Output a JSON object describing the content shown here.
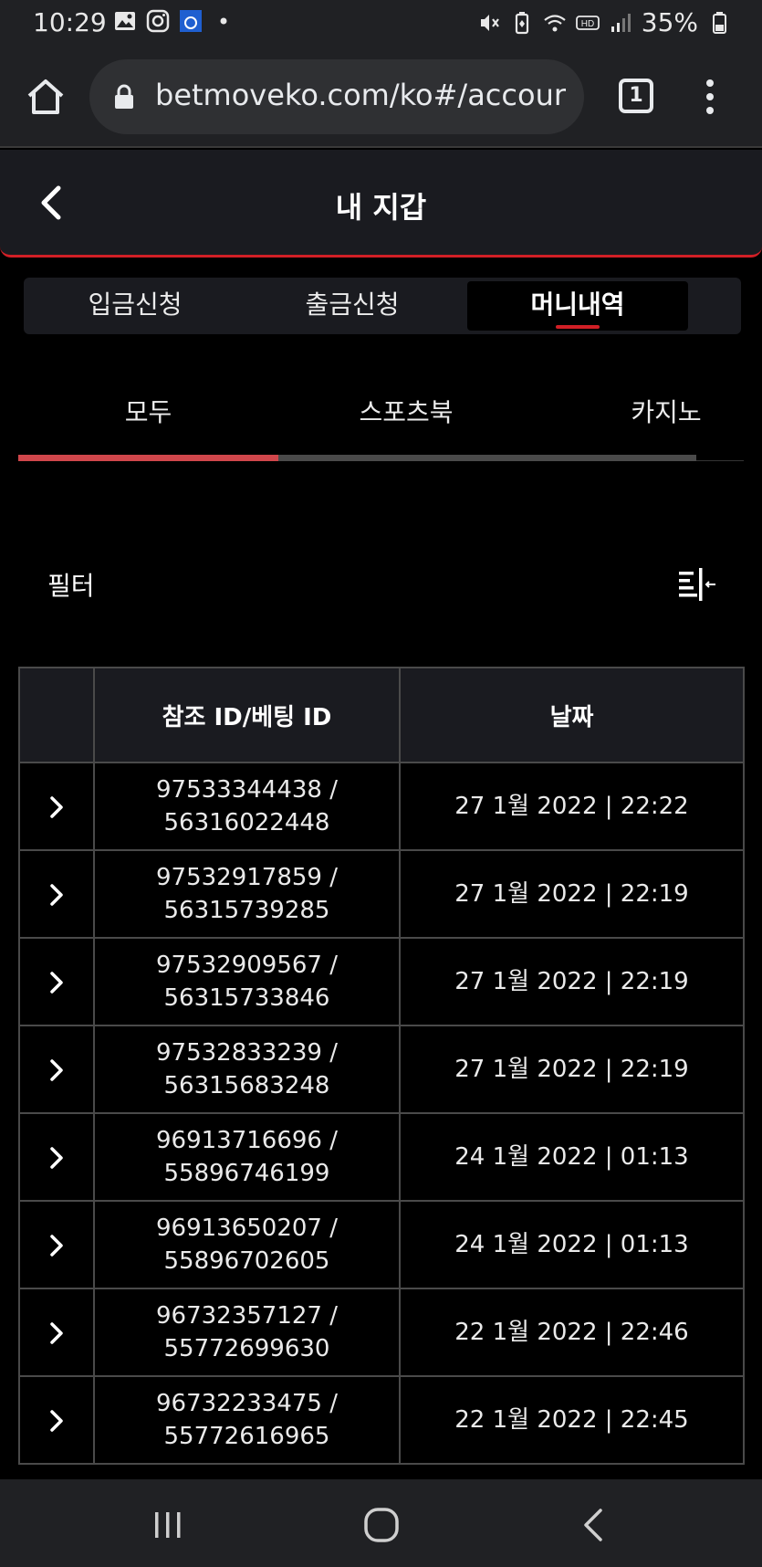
{
  "status_bar": {
    "time": "10:29",
    "battery": "35%",
    "icons": [
      "gallery-icon",
      "instagram-icon",
      "app-icon",
      "dot-icon",
      "mute-icon",
      "battery-saver-icon",
      "wifi-icon",
      "hd-icon",
      "signal-icon",
      "battery-icon"
    ]
  },
  "browser": {
    "url": "betmoveko.com/ko#/accour",
    "tab_count": "1"
  },
  "header": {
    "title": "내 지갑"
  },
  "main_tabs": [
    {
      "label": "입금신청",
      "active": false
    },
    {
      "label": "출금신청",
      "active": false
    },
    {
      "label": "머니내역",
      "active": true
    }
  ],
  "sub_tabs": [
    {
      "label": "모두",
      "active": true
    },
    {
      "label": "스포츠북",
      "active": false
    },
    {
      "label": "카지노",
      "active": false
    }
  ],
  "filter": {
    "label": "필터"
  },
  "table": {
    "headers": [
      "",
      "참조 ID/베팅 ID",
      "날짜"
    ],
    "rows": [
      {
        "ref_id": "97533344438 /",
        "bet_id": "56316022448",
        "date": "27 1월 2022 | 22:22"
      },
      {
        "ref_id": "97532917859 /",
        "bet_id": "56315739285",
        "date": "27 1월 2022 | 22:19"
      },
      {
        "ref_id": "97532909567 /",
        "bet_id": "56315733846",
        "date": "27 1월 2022 | 22:19"
      },
      {
        "ref_id": "97532833239 /",
        "bet_id": "56315683248",
        "date": "27 1월 2022 | 22:19"
      },
      {
        "ref_id": "96913716696 /",
        "bet_id": "55896746199",
        "date": "24 1월 2022 | 01:13"
      },
      {
        "ref_id": "96913650207 /",
        "bet_id": "55896702605",
        "date": "24 1월 2022 | 01:13"
      },
      {
        "ref_id": "96732357127 /",
        "bet_id": "55772699630",
        "date": "22 1월 2022 | 22:46"
      },
      {
        "ref_id": "96732233475 /",
        "bet_id": "55772616965",
        "date": "22 1월 2022 | 22:45"
      }
    ]
  },
  "colors": {
    "accent": "#d11f26",
    "header_bg": "#1a1b20",
    "background": "#000000",
    "border": "#4a4a4a"
  }
}
